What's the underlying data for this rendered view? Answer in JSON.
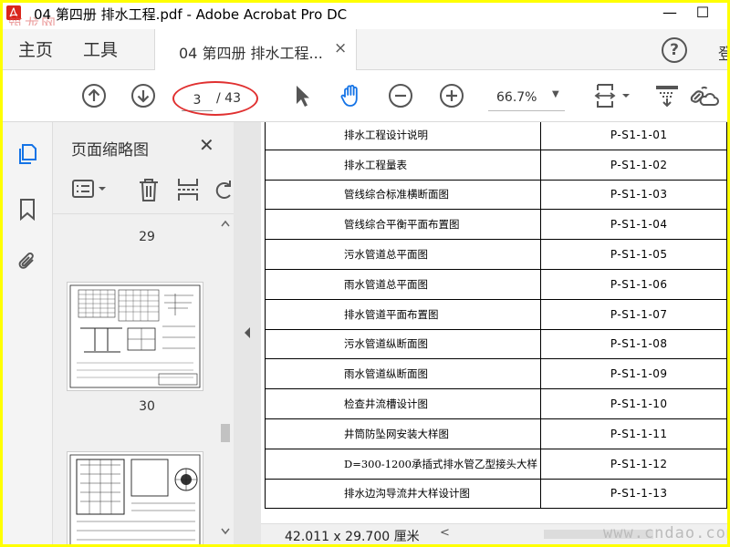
{
  "window": {
    "title": "04 第四册 排水工程.pdf - Adobe Acrobat Pro DC",
    "minimize": "—",
    "maximize": "☐",
    "watermark_logo": "筑龙网"
  },
  "menu": {
    "home": "主页",
    "tools": "工具",
    "tab_label": "04 第四册 排水工程...",
    "tab_close": "×",
    "help": "?",
    "login": "登"
  },
  "toolbar": {
    "current_page": "3",
    "total_pages": "/ 43",
    "zoom": "66.7%",
    "zoom_caret": "▼",
    "highlight_color": "#e03030",
    "icons": [
      "arrow-up-circle-icon",
      "arrow-down-circle-icon",
      "select-arrow-icon",
      "hand-tool-icon",
      "zoom-out-icon",
      "zoom-in-icon",
      "page-display-icon",
      "scroll-mode-icon",
      "link-cloud-icon"
    ]
  },
  "sidebar": {
    "icons": [
      "page-thumbnails-icon",
      "bookmark-icon",
      "attachment-icon"
    ]
  },
  "thumbnails_panel": {
    "title": "页面缩略图",
    "close": "✕",
    "page_labels": [
      "29",
      "30"
    ]
  },
  "document": {
    "rows": [
      {
        "name": "排水工程设计说明",
        "code": "P-S1-1-01"
      },
      {
        "name": "排水工程量表",
        "code": "P-S1-1-02"
      },
      {
        "name": "管线综合标准横断面图",
        "code": "P-S1-1-03"
      },
      {
        "name": "管线综合平衡平面布置图",
        "code": "P-S1-1-04"
      },
      {
        "name": "污水管道总平面图",
        "code": "P-S1-1-05"
      },
      {
        "name": "雨水管道总平面图",
        "code": "P-S1-1-06"
      },
      {
        "name": "排水管道平面布置图",
        "code": "P-S1-1-07"
      },
      {
        "name": "污水管道纵断面图",
        "code": "P-S1-1-08"
      },
      {
        "name": "雨水管道纵断面图",
        "code": "P-S1-1-09"
      },
      {
        "name": "检查井流槽设计图",
        "code": "P-S1-1-10"
      },
      {
        "name": "井筒防坠网安装大样图",
        "code": "P-S1-1-11"
      },
      {
        "name": "D=300-1200承插式排水管乙型接头大样",
        "code": "P-S1-1-12"
      },
      {
        "name": "排水边沟导流井大样设计图",
        "code": "P-S1-1-13"
      }
    ]
  },
  "statusbar": {
    "page_size": "42.011 x 29.700 厘米",
    "scroll_left": "<",
    "site_watermark": "www.cndao.com"
  }
}
